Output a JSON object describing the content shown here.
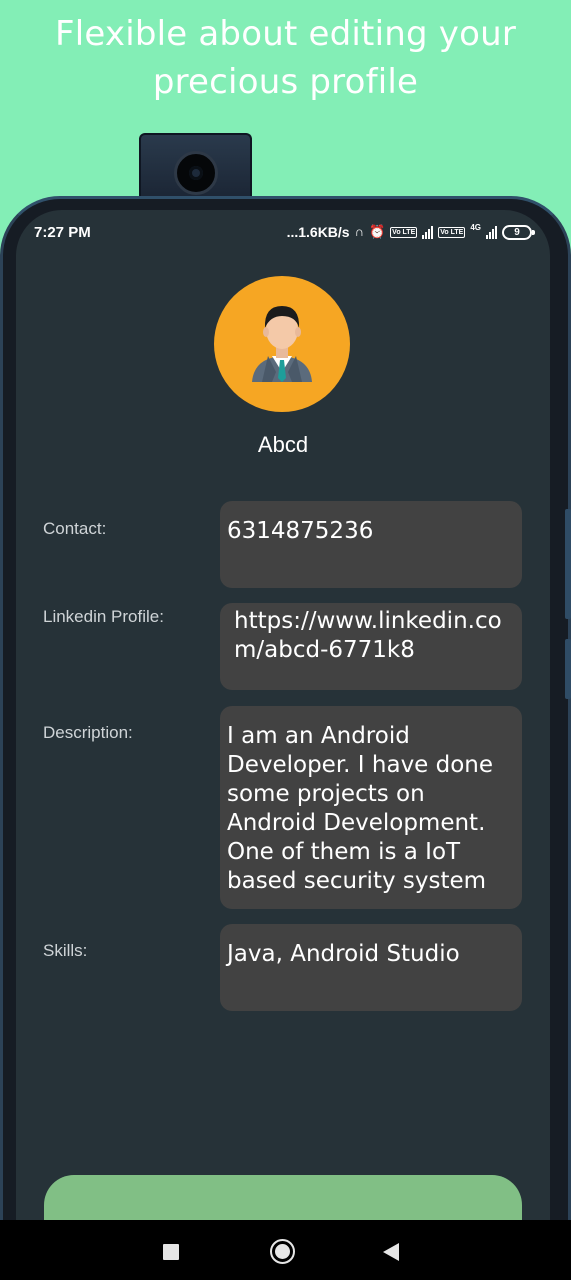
{
  "promo": {
    "headline_line1": "Flexible about editing your",
    "headline_line2": "precious profile"
  },
  "status_bar": {
    "time": "7:27 PM",
    "net_speed": "...1.6KB/s",
    "sim1_tag": "Vo LTE",
    "sim2_tag": "Vo LTE",
    "sim2_network": "4G",
    "battery_level": "9"
  },
  "profile": {
    "avatar_icon": "businessman-avatar-icon",
    "name": "Abcd",
    "fields": [
      {
        "label": "Contact:",
        "value": "6314875236"
      },
      {
        "label": "Linkedin Profile:",
        "value": "https://www.linkedin.com/abcd-6771k8"
      },
      {
        "label": "Description:",
        "value": "I am an Android Developer. I have done some projects on Android Development. One of them is a IoT based security system"
      },
      {
        "label": "Skills:",
        "value": "Java, Android Studio"
      }
    ]
  },
  "colors": {
    "background": "#83eeb6",
    "screen": "#263238",
    "field_box": "#424242",
    "avatar_bg": "#f6a623",
    "button": "#81bf85"
  },
  "nav": {
    "recents_icon": "square-recents-icon",
    "home_icon": "circle-home-icon",
    "back_icon": "triangle-back-icon"
  }
}
